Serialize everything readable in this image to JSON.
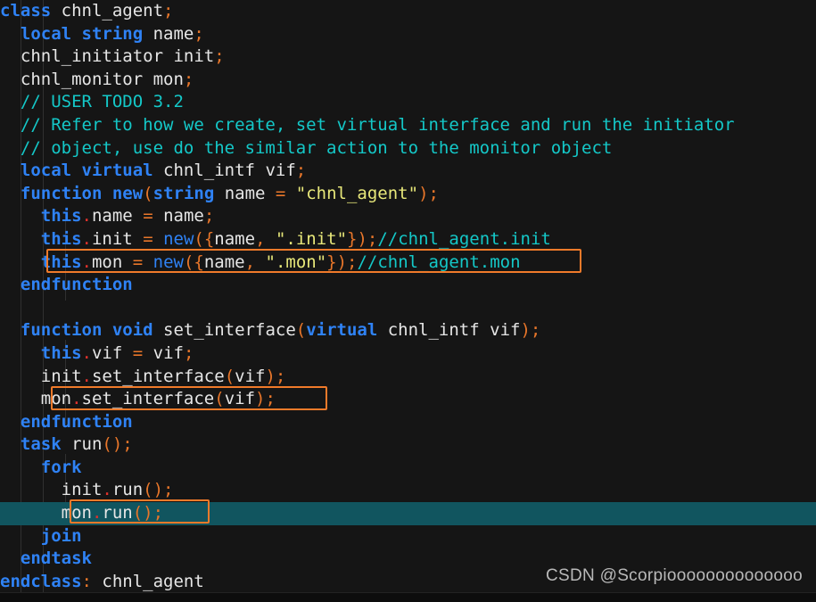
{
  "editor": {
    "background": "#151515",
    "highlight_line_background": "#11555f",
    "box_border_color": "#f07a2a",
    "language": "SystemVerilog",
    "font_size_px": 19,
    "line_height_px": 25.6
  },
  "colors": {
    "keyword": "#2f82f5",
    "identifier": "#e6e6e6",
    "punctuation": "#e8762a",
    "dot_operator": "#e0312c",
    "string": "#e8e87a",
    "comment": "#14c8c8",
    "indent_guide": "#3a3a3a"
  },
  "code": {
    "lines": [
      {
        "n": 1,
        "indent": 0,
        "text": "class chnl_agent;"
      },
      {
        "n": 2,
        "indent": 1,
        "text": "local string name;"
      },
      {
        "n": 3,
        "indent": 1,
        "text": "chnl_initiator init;"
      },
      {
        "n": 4,
        "indent": 1,
        "text": "chnl_monitor mon;"
      },
      {
        "n": 5,
        "indent": 1,
        "text": "// USER TODO 3.2"
      },
      {
        "n": 6,
        "indent": 1,
        "text": "// Refer to how we create, set virtual interface and run the initiator"
      },
      {
        "n": 7,
        "indent": 1,
        "text": "// object, use do the similar action to the monitor object"
      },
      {
        "n": 8,
        "indent": 1,
        "text": "local virtual chnl_intf vif;"
      },
      {
        "n": 9,
        "indent": 1,
        "text": "function new(string name = \"chnl_agent\");"
      },
      {
        "n": 10,
        "indent": 2,
        "text": "this.name = name;"
      },
      {
        "n": 11,
        "indent": 2,
        "text": "this.init = new({name, \".init\"});//chnl_agent.init"
      },
      {
        "n": 12,
        "indent": 2,
        "text": "this.mon = new({name, \".mon\"});//chnl_agent.mon"
      },
      {
        "n": 13,
        "indent": 1,
        "text": "endfunction"
      },
      {
        "n": 14,
        "indent": 0,
        "text": ""
      },
      {
        "n": 15,
        "indent": 1,
        "text": "function void set_interface(virtual chnl_intf vif);"
      },
      {
        "n": 16,
        "indent": 2,
        "text": "this.vif = vif;"
      },
      {
        "n": 17,
        "indent": 2,
        "text": "init.set_interface(vif);"
      },
      {
        "n": 18,
        "indent": 2,
        "text": "mon.set_interface(vif);"
      },
      {
        "n": 19,
        "indent": 1,
        "text": "endfunction"
      },
      {
        "n": 20,
        "indent": 1,
        "text": "task run();"
      },
      {
        "n": 21,
        "indent": 2,
        "text": "fork"
      },
      {
        "n": 22,
        "indent": 3,
        "text": "init.run();"
      },
      {
        "n": 23,
        "indent": 3,
        "text": "mon.run();"
      },
      {
        "n": 24,
        "indent": 2,
        "text": "join"
      },
      {
        "n": 25,
        "indent": 1,
        "text": "endtask"
      },
      {
        "n": 26,
        "indent": 0,
        "text": "endclass: chnl_agent"
      }
    ],
    "highlighted_line": 23,
    "annotation_boxes": [
      {
        "label": "this-mon-new-box",
        "line": 12
      },
      {
        "label": "mon-set-interface-box",
        "line": 18
      },
      {
        "label": "mon-run-box",
        "line": 23
      }
    ]
  },
  "watermark": {
    "text": "CSDN @Scorpioooooooooooooo"
  }
}
